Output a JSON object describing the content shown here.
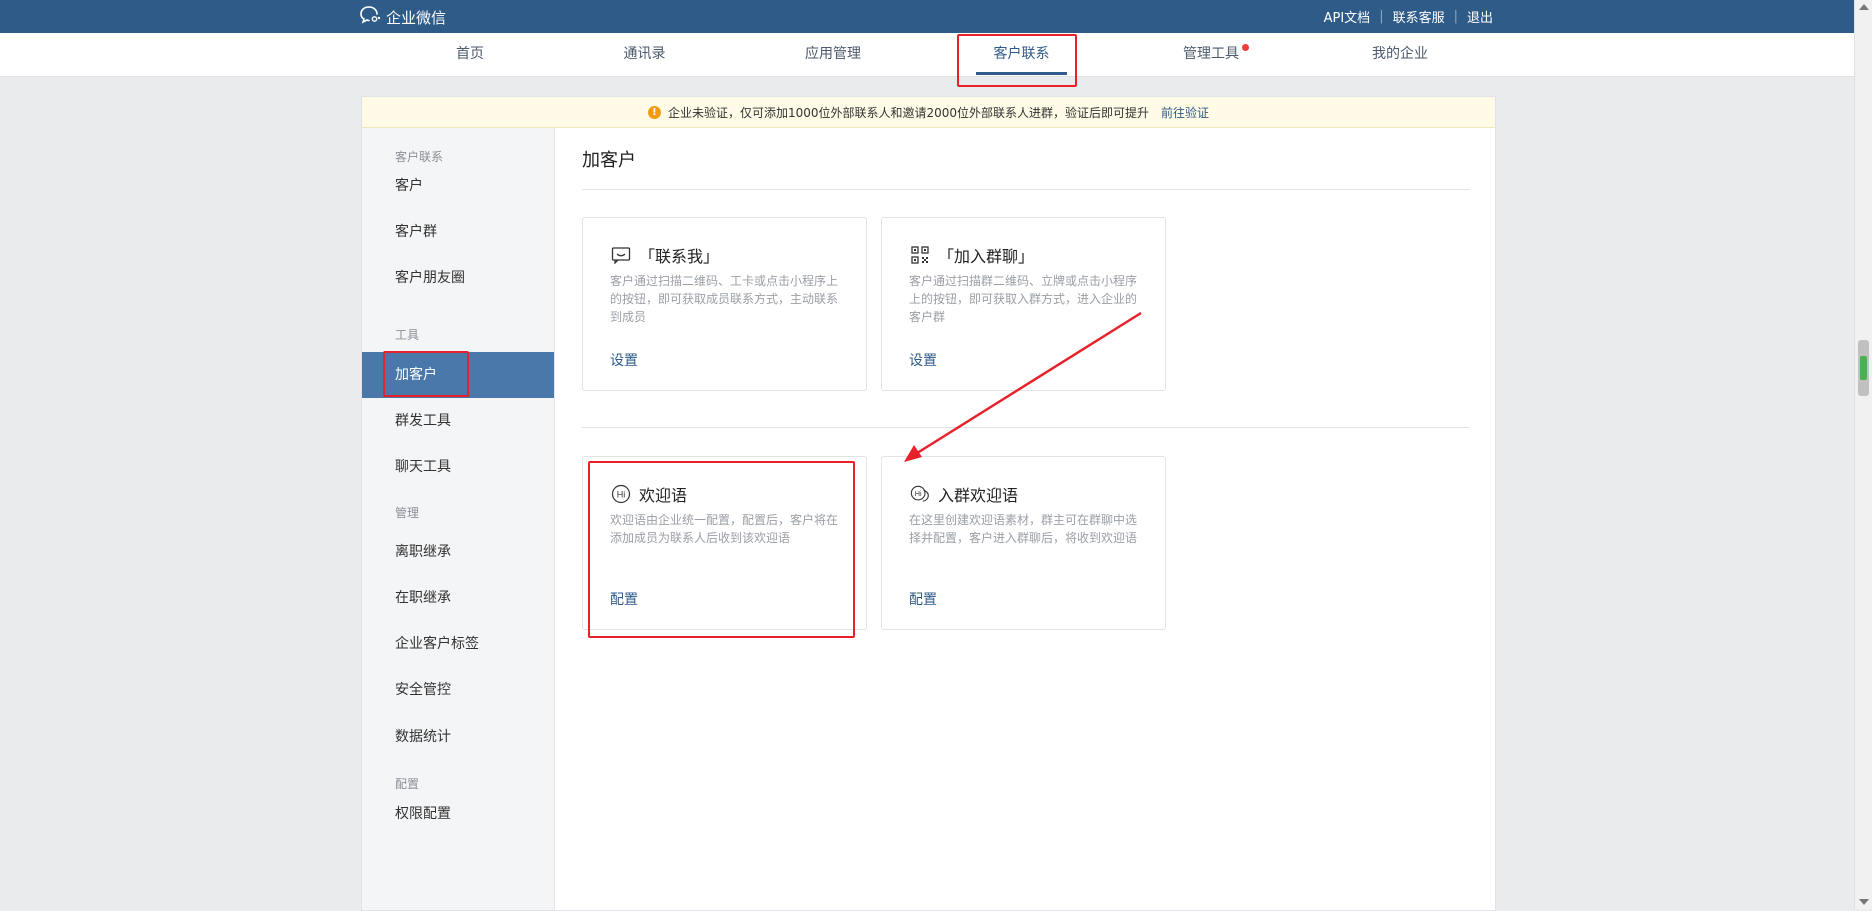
{
  "header": {
    "logo_text": "企业微信",
    "links": [
      "API文档",
      "联系客服",
      "退出"
    ]
  },
  "nav": {
    "items": [
      "首页",
      "通讯录",
      "应用管理",
      "客户联系",
      "管理工具",
      "我的企业"
    ],
    "active_index": 3,
    "badge_on_index": 4
  },
  "notice": {
    "text": "企业未验证，仅可添加1000位外部联系人和邀请2000位外部联系人进群，验证后即可提升",
    "link": "前往验证"
  },
  "sidebar": {
    "groups": [
      {
        "label": "客户联系",
        "items": [
          "客户",
          "客户群",
          "客户朋友圈"
        ]
      },
      {
        "label": "工具",
        "items": [
          "加客户",
          "群发工具",
          "聊天工具"
        ]
      },
      {
        "label": "管理",
        "items": [
          "离职继承",
          "在职继承",
          "企业客户标签",
          "安全管控",
          "数据统计"
        ]
      },
      {
        "label": "配置",
        "items": [
          "权限配置"
        ]
      }
    ],
    "active_item": "加客户"
  },
  "main": {
    "title": "加客户",
    "cards": [
      {
        "icon": "chat-smile-icon",
        "title": "「联系我」",
        "desc": "客户通过扫描二维码、工卡或点击小程序上的按钮，即可获取成员联系方式，主动联系到成员",
        "action": "设置"
      },
      {
        "icon": "qr-code-icon",
        "title": "「加入群聊」",
        "desc": "客户通过扫描群二维码、立牌或点击小程序上的按钮，即可获取入群方式，进入企业的客户群",
        "action": "设置"
      },
      {
        "icon": "hi-bubble-icon",
        "title": "欢迎语",
        "desc": "欢迎语由企业统一配置，配置后，客户将在添加成员为联系人后收到该欢迎语",
        "action": "配置"
      },
      {
        "icon": "group-hi-bubble-icon",
        "title": "入群欢迎语",
        "desc": "在这里创建欢迎语素材，群主可在群聊中选择并配置，客户进入群聊后，将收到欢迎语",
        "action": "配置"
      }
    ]
  },
  "colors": {
    "header_bg": "#2f5b89",
    "active_sidebar_bg": "#4a78aa",
    "link": "#2f5b89",
    "annotation_red": "#e8202a",
    "notice_bg": "#fffbe6",
    "nav_badge": "#f43b3b"
  }
}
